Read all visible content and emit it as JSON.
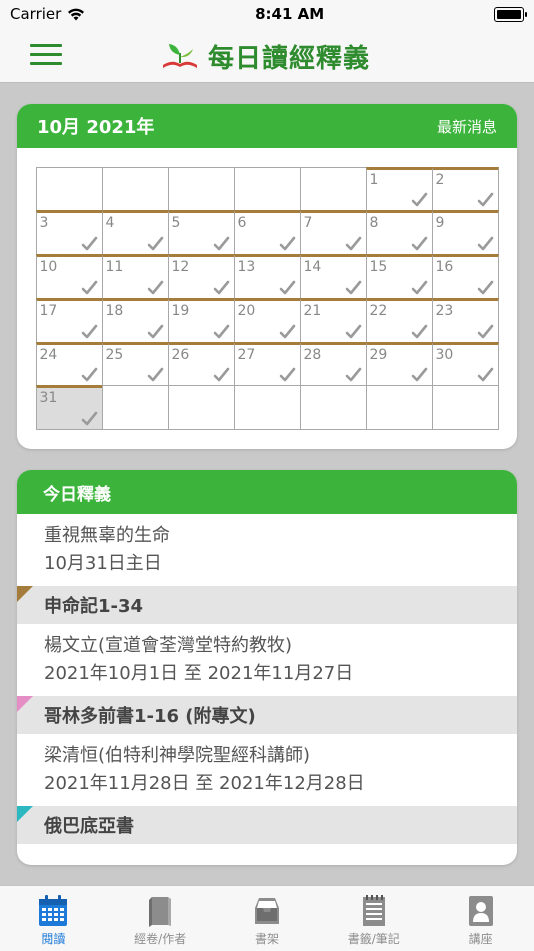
{
  "status_bar": {
    "carrier": "Carrier",
    "time": "8:41 AM"
  },
  "nav": {
    "title": "每日讀經釋義"
  },
  "calendar": {
    "month_title": "10月 2021年",
    "news_label": "最新消息",
    "dates": [
      "",
      "",
      "",
      "",
      "",
      "1",
      "2",
      "3",
      "4",
      "5",
      "6",
      "7",
      "8",
      "9",
      "10",
      "11",
      "12",
      "13",
      "14",
      "15",
      "16",
      "17",
      "18",
      "19",
      "20",
      "21",
      "22",
      "23",
      "24",
      "25",
      "26",
      "27",
      "28",
      "29",
      "30",
      "31",
      "",
      "",
      "",
      "",
      "",
      ""
    ],
    "today": "31"
  },
  "today_section": {
    "header": "今日釋義",
    "title": "重視無辜的生命",
    "date": "10月31日主日"
  },
  "books": [
    {
      "name": "申命記1-34",
      "color": "#a47c3c"
    },
    {
      "name": "哥林多前書1-16 (附專文)",
      "color": "#e58ec6"
    },
    {
      "name": "俄巴底亞書",
      "color": "#2bb8c0"
    }
  ],
  "authors": [
    {
      "name": "楊文立(宣道會荃灣堂特約教牧)",
      "range": "2021年10月1日 至 2021年11月27日"
    },
    {
      "name": "梁清恒(伯特利神學院聖經科講師)",
      "range": "2021年11月28日 至 2021年12月28日"
    }
  ],
  "tabs": [
    {
      "label": "閱讀",
      "icon": "calendar-icon",
      "active": true
    },
    {
      "label": "經卷/作者",
      "icon": "book-icon",
      "active": false
    },
    {
      "label": "書架",
      "icon": "tray-icon",
      "active": false
    },
    {
      "label": "書籤/筆記",
      "icon": "notepad-icon",
      "active": false
    },
    {
      "label": "講座",
      "icon": "person-icon",
      "active": false
    }
  ],
  "colors": {
    "brand_green": "#3cb43c",
    "title_green": "#2e8b2e",
    "tab_active": "#1e7ad8"
  }
}
